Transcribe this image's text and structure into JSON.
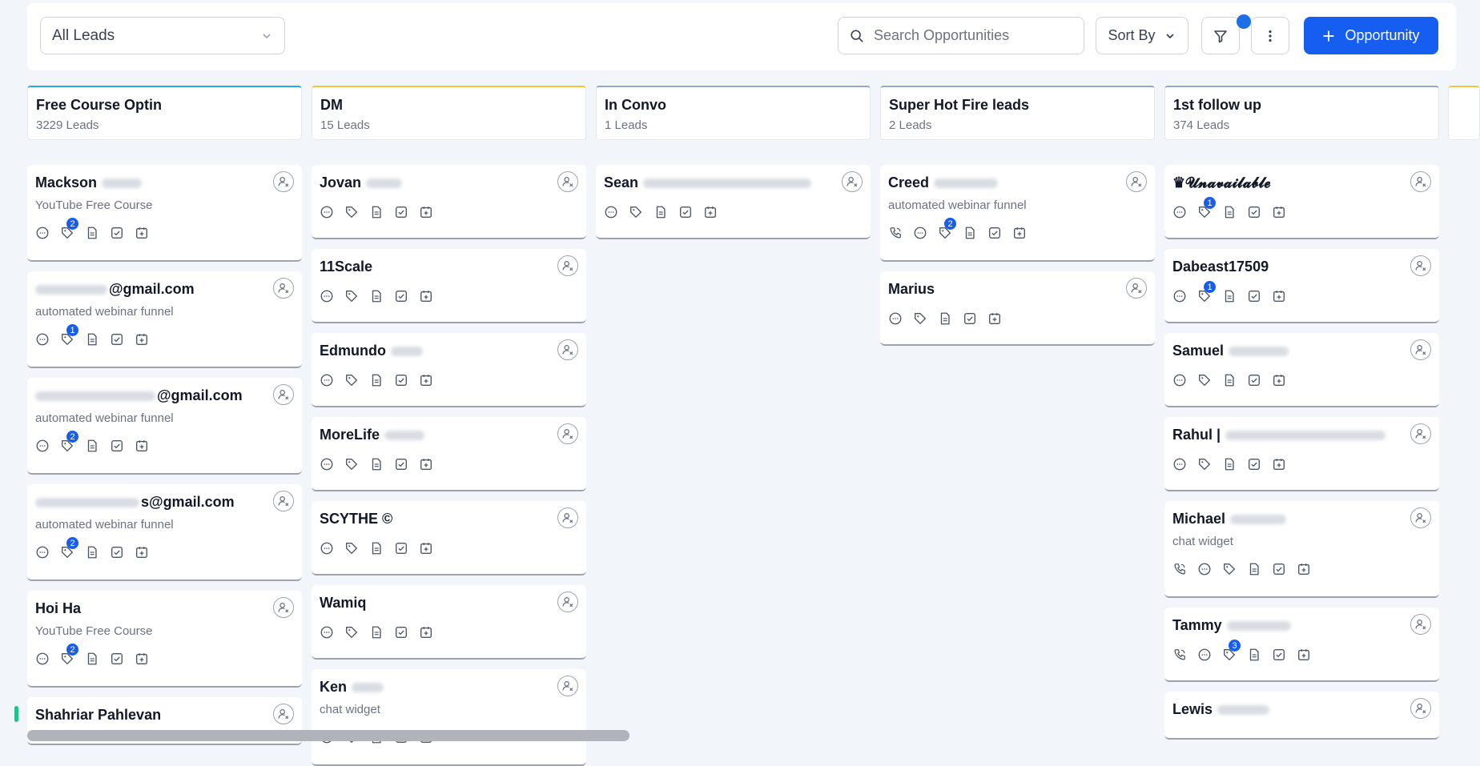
{
  "toolbar": {
    "pipeline_select": "All Leads",
    "search_placeholder": "Search Opportunities",
    "sort_label": "Sort By",
    "add_label": "Opportunity"
  },
  "columns": [
    {
      "title": "Free Course Optin",
      "count": "3229 Leads",
      "color": "#2aa8e0"
    },
    {
      "title": "DM",
      "count": "15 Leads",
      "color": "#f5c542"
    },
    {
      "title": "In Convo",
      "count": "1 Leads",
      "color": "#8fa8c8"
    },
    {
      "title": "Super Hot Fire leads",
      "count": "2 Leads",
      "color": "#8fa8c8"
    },
    {
      "title": "1st follow up",
      "count": "374 Leads",
      "color": "#8fa8c8"
    }
  ],
  "cards": {
    "col0": [
      {
        "name": "Mackson",
        "source": "YouTube Free Course",
        "badge": "2"
      },
      {
        "name": "@gmail.com",
        "source": "automated webinar funnel",
        "badge": "1"
      },
      {
        "name": "@gmail.com",
        "source": "automated webinar funnel",
        "badge": "2"
      },
      {
        "name": "s@gmail.com",
        "source": "automated webinar funnel",
        "badge": "2"
      },
      {
        "name": "Hoi Ha",
        "source": "YouTube Free Course",
        "badge": "2"
      },
      {
        "name": "Shahriar Pahlevan"
      }
    ],
    "col1": [
      {
        "name": "Jovan"
      },
      {
        "name": "11Scale"
      },
      {
        "name": "Edmundo"
      },
      {
        "name": "MoreLife"
      },
      {
        "name": "SCYTHE ©"
      },
      {
        "name": "Wamiq"
      },
      {
        "name": "Ken",
        "source": "chat widget"
      }
    ],
    "col2": [
      {
        "name": "Sean"
      }
    ],
    "col3": [
      {
        "name": "Creed",
        "source": "automated webinar funnel",
        "badge": "2"
      },
      {
        "name": "Marius"
      }
    ],
    "col4": [
      {
        "name": "♛𝓤𝓷𝓪𝓿𝓪𝓲𝓵𝓪𝓫𝓵𝓮",
        "badge": "1"
      },
      {
        "name": "Dabeast17509",
        "badge": "1"
      },
      {
        "name": "Samuel"
      },
      {
        "name": "Rahul |"
      },
      {
        "name": "Michael",
        "source": "chat widget"
      },
      {
        "name": "Tammy",
        "badge": "3"
      },
      {
        "name": "Lewis"
      }
    ]
  },
  "icons": [
    "search-icon",
    "chevron-down-icon",
    "filter-icon",
    "more-vertical-icon",
    "plus-icon",
    "assign-user-icon",
    "message-icon",
    "tag-icon",
    "note-icon",
    "task-icon",
    "calendar-icon",
    "phone-icon"
  ],
  "accent": "#155eef"
}
